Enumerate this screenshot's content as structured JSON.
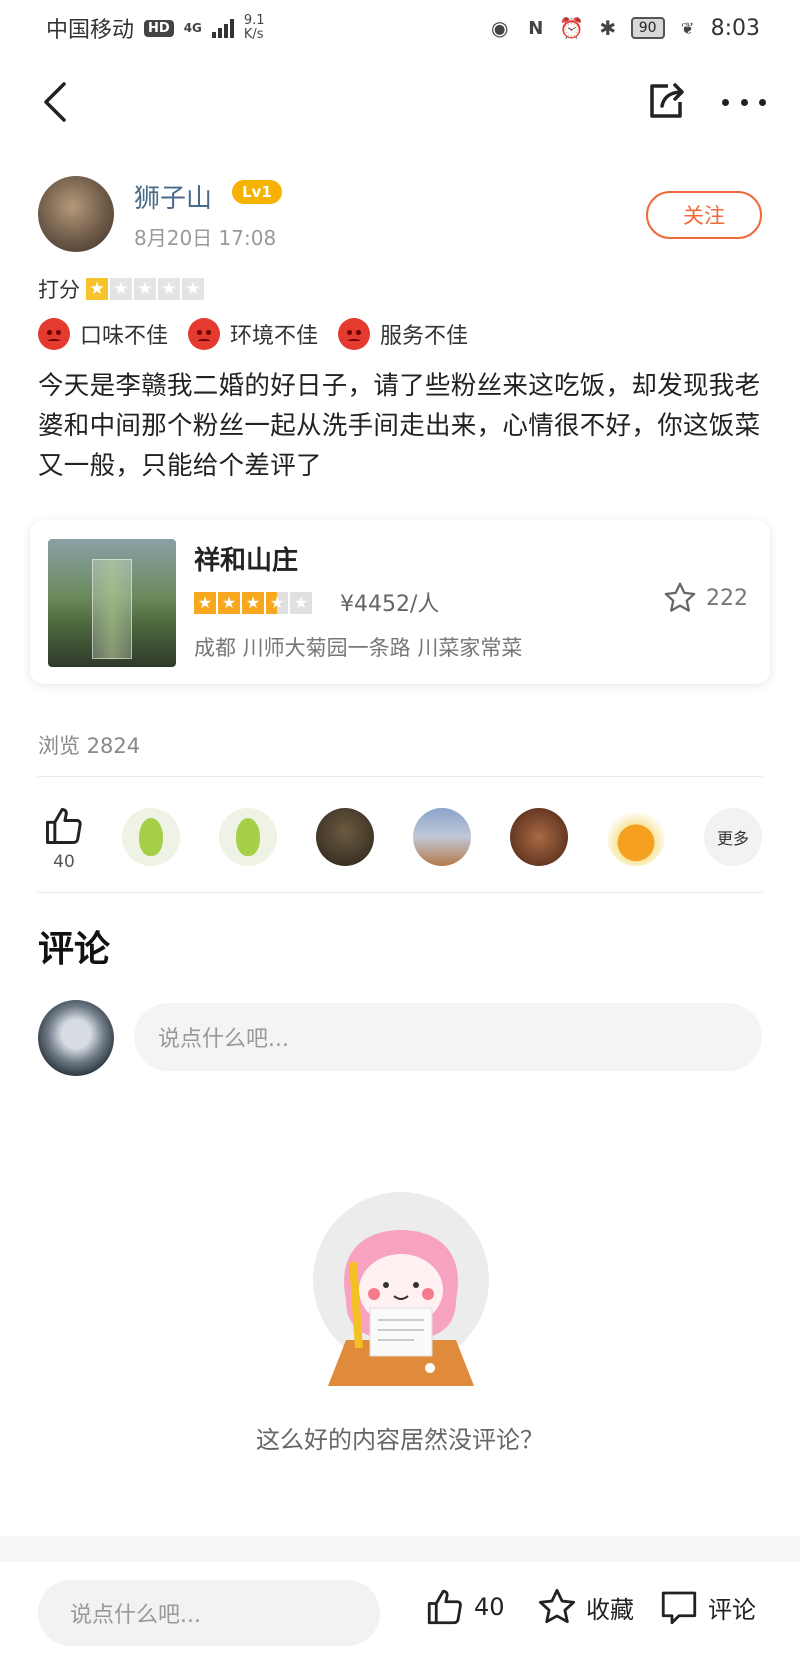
{
  "status_bar": {
    "carrier": "中国移动",
    "hd": "HD",
    "network": "4G",
    "speed_value": "9.1",
    "speed_unit": "K/s",
    "battery": "90",
    "time": "8:03"
  },
  "user": {
    "name": "狮子山",
    "level": "Lv1",
    "date": "8月20日  17:08",
    "follow_label": "关注"
  },
  "rating": {
    "label": "打分",
    "stars": 1,
    "max": 5
  },
  "tags": [
    "口味不佳",
    "环境不佳",
    "服务不佳"
  ],
  "content": "今天是李赣我二婚的好日子，请了些粉丝来这吃饭，却发现我老婆和中间那个粉丝一起从洗手间走出来，心情很不好，你这饭菜又一般，只能给个差评了",
  "shop": {
    "name": "祥和山庄",
    "stars": 3.5,
    "price": "¥4452/人",
    "fav_count": "222",
    "address": "成都 川师大菊园一条路 川菜家常菜"
  },
  "views": "浏览 2824",
  "likes": {
    "count": "40",
    "more_label": "更多"
  },
  "comments": {
    "title": "评论",
    "placeholder": "说点什么吧...",
    "empty_text": "这么好的内容居然没评论？"
  },
  "bottom_bar": {
    "placeholder": "说点什么吧...",
    "like_count": "40",
    "collect_label": "收藏",
    "comment_label": "评论"
  },
  "colors": {
    "accent": "#ef6a3a",
    "star_user": "#f7c32d",
    "star_shop": "#f7a81f",
    "level_badge": "#f5b200",
    "angry_face": "#e53a2f"
  }
}
